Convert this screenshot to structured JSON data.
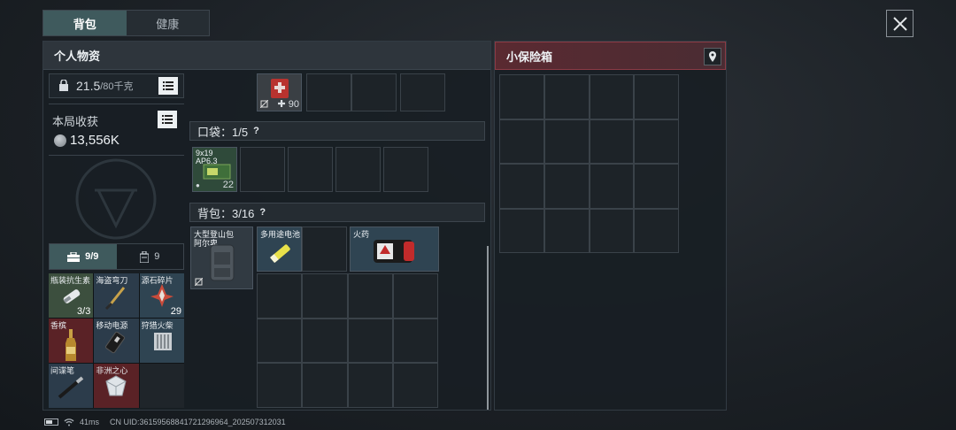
{
  "tabs": {
    "backpack": "背包",
    "health": "健康"
  },
  "left_panel": {
    "title": "个人物资"
  },
  "weight": {
    "current": "21.5",
    "max": "/80千克"
  },
  "earnings": {
    "label": "本局收获",
    "value": "13,556K"
  },
  "inventory_tabs": {
    "equipment_count": "9/9",
    "consumable_count": "9"
  },
  "items_small": [
    {
      "label": "瓶装抗生素",
      "count": "3/3"
    },
    {
      "label": "海盗弯刀",
      "count": ""
    },
    {
      "label": "源石碎片",
      "count": "29"
    },
    {
      "label": "香槟",
      "count": ""
    },
    {
      "label": "移动电源",
      "count": ""
    },
    {
      "label": "狩猎火柴",
      "count": ""
    },
    {
      "label": "间谍笔",
      "count": ""
    },
    {
      "label": "非洲之心",
      "count": ""
    }
  ],
  "top_item": {
    "count": "90"
  },
  "pocket": {
    "label": "口袋：1/5",
    "help": "?"
  },
  "ammo": {
    "name": "9x19",
    "sub": "AP6.3",
    "count": "22"
  },
  "backpack_section": {
    "label": "背包：3/16",
    "help": "?"
  },
  "backpack_items": [
    {
      "name": "大型登山包",
      "sub": "阿尔卑"
    },
    {
      "name": "多用途电池"
    },
    {
      "name": "火药"
    }
  ],
  "right_panel": {
    "title": "小保险箱"
  },
  "status": {
    "ping": "41ms",
    "uid": "CN UID:36159568841721296964_202507312031"
  },
  "colors": {
    "accent_teal": "#3f5a5d",
    "safe_red": "#8b3b45",
    "rare_red": "#5a2226",
    "blue_item": "#2f4452"
  }
}
